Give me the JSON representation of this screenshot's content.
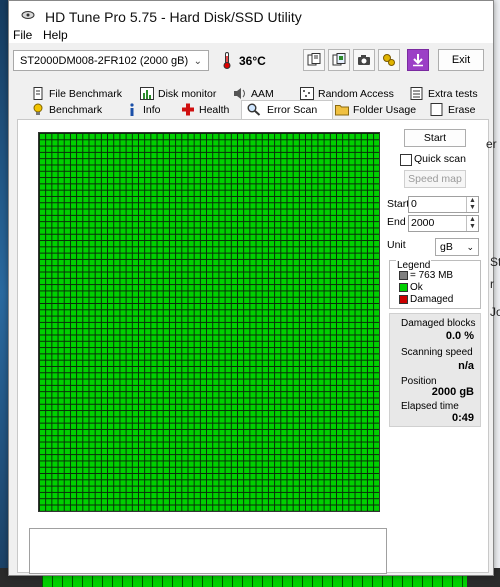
{
  "window": {
    "title": "HD Tune Pro 5.75 - Hard Disk/SSD Utility"
  },
  "menu": {
    "file": "File",
    "help": "Help"
  },
  "toolbar": {
    "drive": "ST2000DM008-2FR102 (2000 gB)",
    "temperature": "36°C",
    "exit_label": "Exit",
    "icons": [
      "copy-icon",
      "copy-info-icon",
      "screenshot-icon",
      "options-icon",
      "save-icon"
    ]
  },
  "tabs_row1": [
    "File Benchmark",
    "Disk monitor",
    "AAM",
    "Random Access",
    "Extra tests"
  ],
  "tabs_row2": [
    "Benchmark",
    "Info",
    "Health",
    "Error Scan",
    "Folder Usage",
    "Erase"
  ],
  "active_tab": "Error Scan",
  "error_scan": {
    "start_button": "Start",
    "quick_scan_label": "Quick scan",
    "quick_scan_checked": false,
    "speed_map_button": "Speed map",
    "start_label": "Start",
    "start_value": "0",
    "end_label": "End",
    "end_value": "2000",
    "unit_label": "Unit",
    "unit_value": "gB",
    "legend": {
      "title": "Legend",
      "block_size": "= 763 MB",
      "ok": "Ok",
      "damaged": "Damaged",
      "colors": {
        "ok": "#00d000",
        "damaged": "#cc0000",
        "block": "#808080"
      }
    },
    "stats": {
      "damaged_blocks_label": "Damaged blocks",
      "damaged_blocks_value": "0.0 %",
      "scanning_speed_label": "Scanning speed",
      "scanning_speed_value": "n/a",
      "position_label": "Position",
      "position_value": "2000 gB",
      "elapsed_label": "Elapsed time",
      "elapsed_value": "0:49"
    }
  },
  "background_edge_text": [
    "er",
    "St",
    "r",
    "Jo"
  ]
}
